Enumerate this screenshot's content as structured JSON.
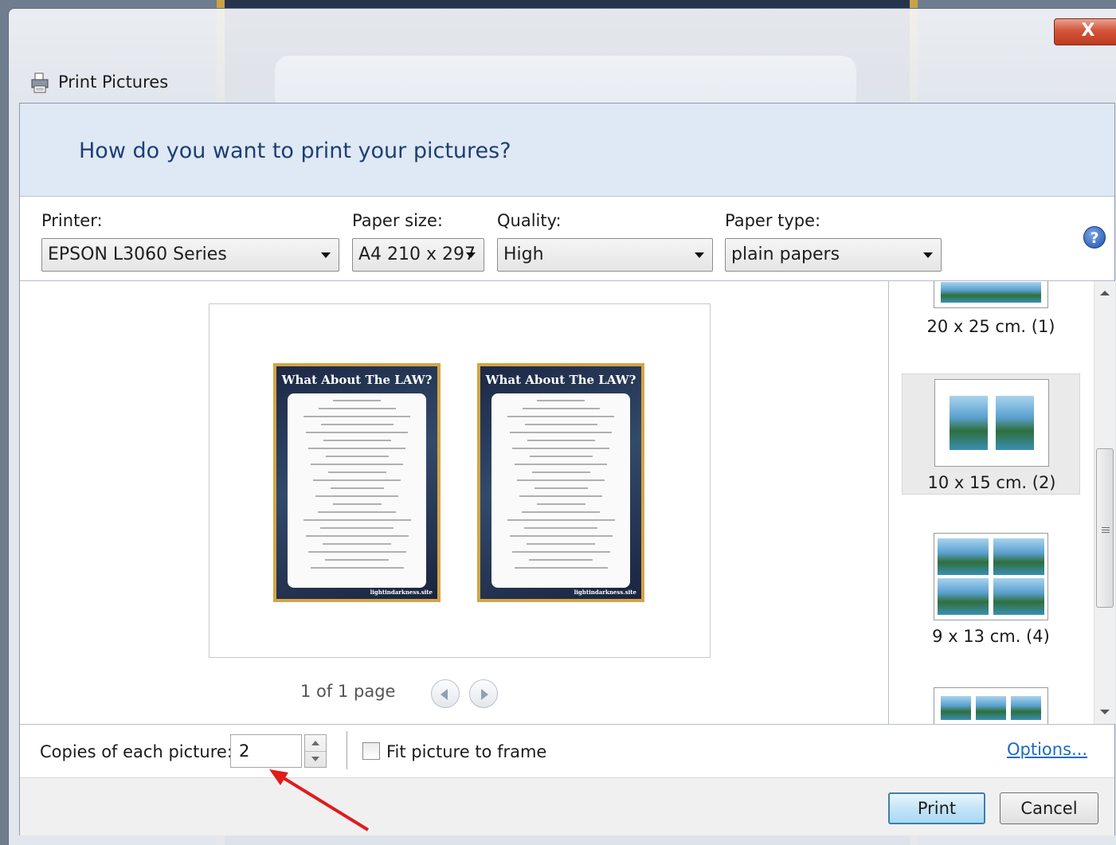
{
  "window": {
    "title": "Print Pictures",
    "close_label": "X",
    "background_poster_title": "What About The LAW?"
  },
  "banner": {
    "heading": "How do you want to print your pictures?"
  },
  "settings": {
    "printer": {
      "label": "Printer:",
      "value": "EPSON L3060 Series"
    },
    "paper_size": {
      "label": "Paper size:",
      "value": "A4 210 x 297"
    },
    "quality": {
      "label": "Quality:",
      "value": "High"
    },
    "paper_type": {
      "label": "Paper type:",
      "value": "plain papers"
    },
    "help_icon": "?"
  },
  "preview": {
    "posters": [
      {
        "title": "What About The LAW?",
        "site": "lightindarkness.site"
      },
      {
        "title": "What About The LAW?",
        "site": "lightindarkness.site"
      }
    ],
    "page_info": "1 of 1 page"
  },
  "layouts": [
    {
      "caption": "20 x 25 cm. (1)",
      "selected": false
    },
    {
      "caption": "10 x 15 cm. (2)",
      "selected": true
    },
    {
      "caption": "9 x 13 cm. (4)",
      "selected": false
    }
  ],
  "options": {
    "copies_label": "Copies of each picture:",
    "copies_value": "2",
    "fit_label": "Fit picture to frame",
    "fit_checked": false,
    "options_link": "Options..."
  },
  "footer": {
    "print_label": "Print",
    "cancel_label": "Cancel"
  },
  "colors": {
    "accent": "#1c6ac8",
    "annotation_arrow": "#e01b1b",
    "close_button": "#c03a1f"
  }
}
